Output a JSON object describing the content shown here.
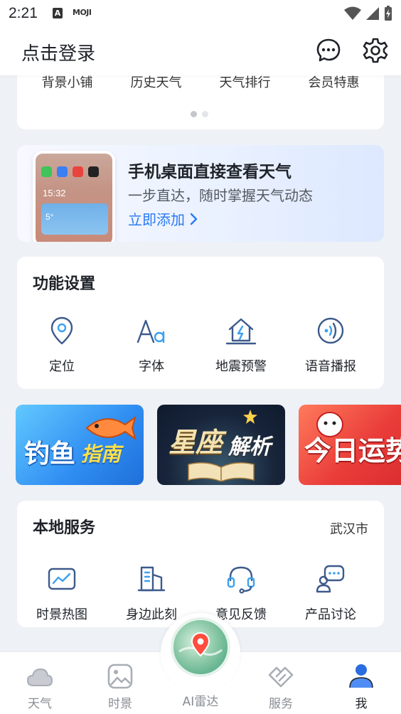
{
  "status_bar": {
    "time": "2:21",
    "app_badge": "A",
    "app_name": "MOJI"
  },
  "header": {
    "title": "点击登录",
    "message_icon": "chat-bubble-icon",
    "settings_icon": "gear-icon"
  },
  "top_card": {
    "items": [
      {
        "label": "背景小铺"
      },
      {
        "label": "历史天气"
      },
      {
        "label": "天气排行"
      },
      {
        "label": "会员特惠"
      }
    ],
    "page_count": 2,
    "active_page": 0
  },
  "promo": {
    "title": "手机桌面直接查看天气",
    "subtitle": "一步直达，随时掌握天气动态",
    "link": "立即添加",
    "phone_time": "15:32",
    "phone_temp": "5°"
  },
  "function_settings": {
    "title": "功能设置",
    "items": [
      {
        "label": "定位",
        "icon": "location-pin-icon"
      },
      {
        "label": "字体",
        "icon": "font-icon"
      },
      {
        "label": "地震预警",
        "icon": "earthquake-house-icon"
      },
      {
        "label": "语音播报",
        "icon": "voice-broadcast-icon"
      }
    ]
  },
  "banners": [
    {
      "text_a": "钓鱼",
      "text_b": "指南",
      "color": "#2f8df2"
    },
    {
      "text_a": "星座",
      "text_b": "解析",
      "color": "#17243a"
    },
    {
      "text_a": "今日运势",
      "color": "#ea3d3a"
    }
  ],
  "local_services": {
    "title": "本地服务",
    "city": "武汉市",
    "items": [
      {
        "label": "时景热图",
        "icon": "heatmap-image-icon"
      },
      {
        "label": "身边此刻",
        "icon": "building-icon"
      },
      {
        "label": "意见反馈",
        "icon": "headset-icon"
      },
      {
        "label": "产品讨论",
        "icon": "discussion-icon"
      }
    ]
  },
  "bottom_nav": {
    "items": [
      {
        "label": "天气",
        "icon": "cloud-icon",
        "active": false
      },
      {
        "label": "时景",
        "icon": "photo-icon",
        "active": false
      },
      {
        "label": "AI雷达",
        "icon": "radar-map-icon",
        "active": false
      },
      {
        "label": "服务",
        "icon": "handshake-icon",
        "active": false
      },
      {
        "label": "我",
        "icon": "person-icon",
        "active": true
      }
    ]
  },
  "colors": {
    "accent": "#2a7af2",
    "icon_stroke": "#3d5a8c",
    "background": "#eef1f5"
  }
}
